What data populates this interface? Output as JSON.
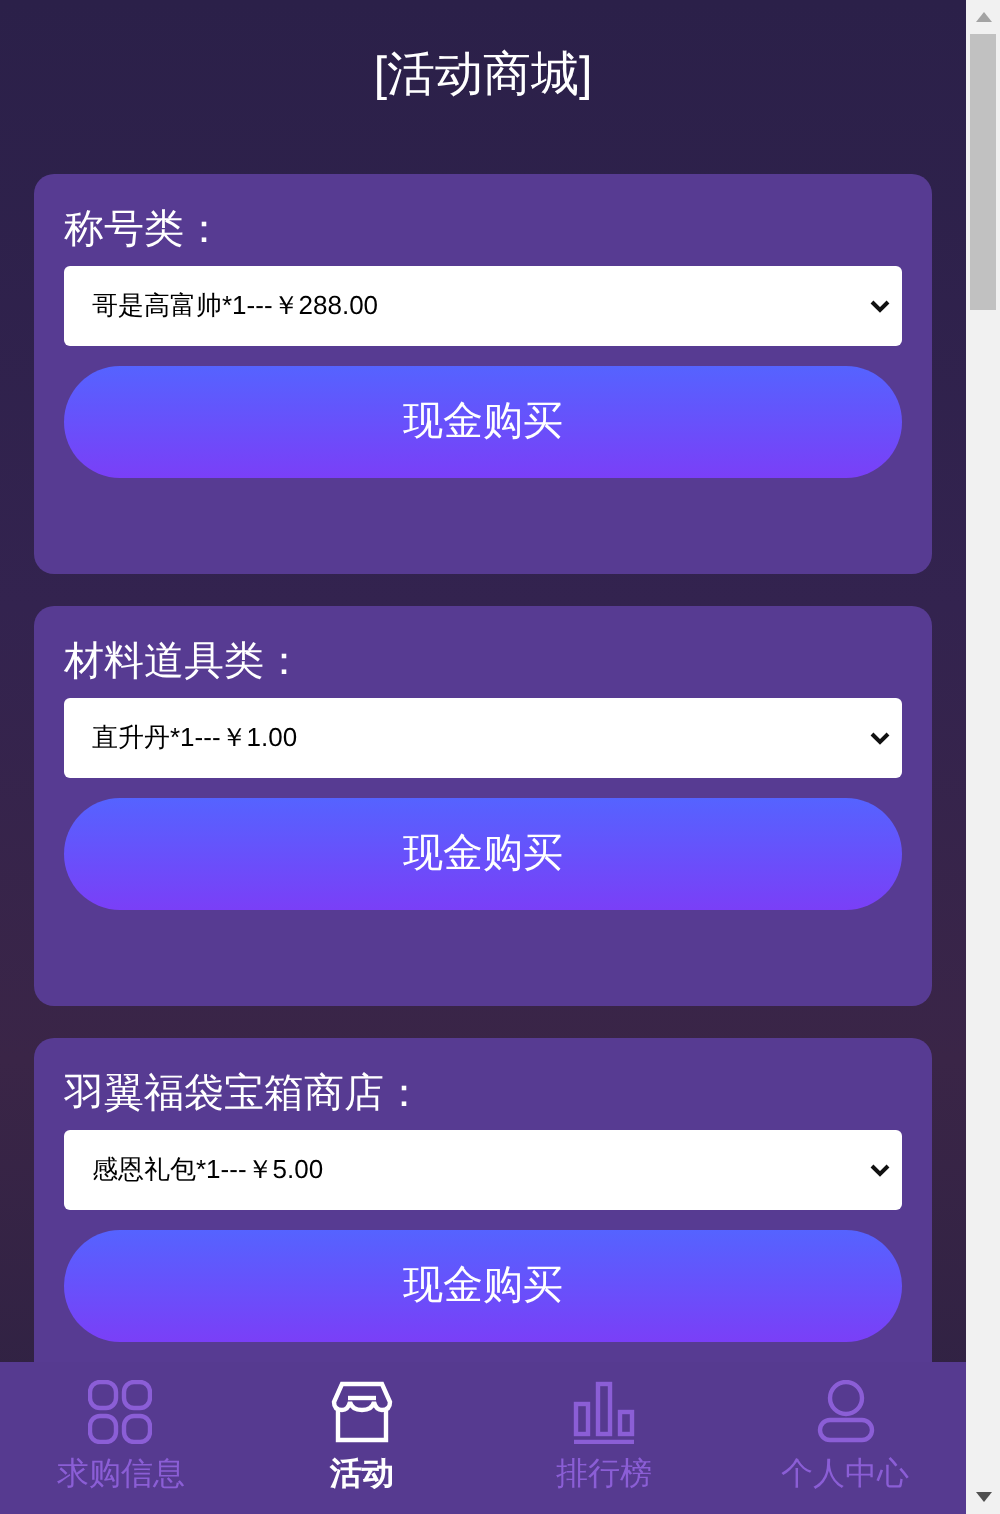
{
  "header": {
    "title": "[活动商城]"
  },
  "sections": [
    {
      "label": "称号类：",
      "selection": "哥是高富帅*1---￥288.00",
      "button": "现金购买"
    },
    {
      "label": "材料道具类：",
      "selection": "直升丹*1---￥1.00",
      "button": "现金购买"
    },
    {
      "label": "羽翼福袋宝箱商店：",
      "selection": "感恩礼包*1---￥5.00",
      "button": "现金购买"
    }
  ],
  "bottom_nav": [
    {
      "label": "求购信息",
      "kind": "grid",
      "selected": false
    },
    {
      "label": "活动",
      "kind": "store",
      "selected": true
    },
    {
      "label": "排行榜",
      "kind": "chart",
      "selected": false
    },
    {
      "label": "个人中心",
      "kind": "person",
      "selected": false
    }
  ]
}
